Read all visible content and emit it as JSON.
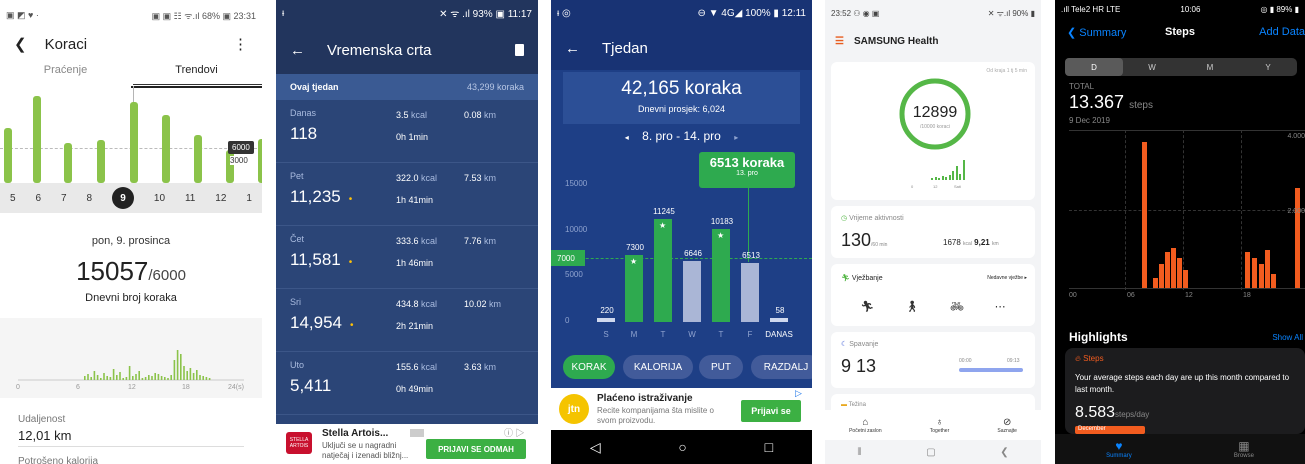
{
  "p1": {
    "status_left": "▣ ◩ ♥ ·",
    "status_right": "▣ ▣ ☷ ᯤ.ıl 68% ▣ 23:31",
    "title": "Koraci",
    "menu": "⋮",
    "tabs": [
      "Praćenje",
      "Trendovi"
    ],
    "goal_label": "6000",
    "goal2": "3000",
    "days": [
      "5",
      "6",
      "7",
      "8",
      "9",
      "10",
      "11",
      "12",
      "1"
    ],
    "bar_levels": [
      0.58,
      0.92,
      0.42,
      0.45,
      0.85,
      0.72,
      0.5,
      0.35,
      0.46
    ],
    "date": "pon, 9. prosinca",
    "steps": "15057",
    "goal": "/6000",
    "steps_label": "Dnevni broj koraka",
    "axis": [
      "0",
      "6",
      "12",
      "18",
      "24(s)"
    ],
    "dist_label": "Udaljenost",
    "dist_val": "12,01 km",
    "cal_label": "Potrošeno kalorija"
  },
  "p2": {
    "status_left": "ᵻ",
    "status_right": "✕ ᯤ .ıl 93% ▣ 11:17",
    "title": "Vremenska crta",
    "week_label": "Ovaj tjedan",
    "week_total": "43,299 koraka",
    "rows": [
      {
        "day": "Danas",
        "steps": "118",
        "kcal": "3.5",
        "kcal_u": "kcal",
        "time": "0h 1min",
        "km": "0.08",
        "km_u": "km",
        "star": ""
      },
      {
        "day": "Pet",
        "steps": "11,235",
        "kcal": "322.0",
        "kcal_u": "kcal",
        "time": "1h 41min",
        "km": "7.53",
        "km_u": "km",
        "star": "•"
      },
      {
        "day": "Čet",
        "steps": "11,581",
        "kcal": "333.6",
        "kcal_u": "kcal",
        "time": "1h 46min",
        "km": "7.76",
        "km_u": "km",
        "star": "•"
      },
      {
        "day": "Sri",
        "steps": "14,954",
        "kcal": "434.8",
        "kcal_u": "kcal",
        "time": "2h 21min",
        "km": "10.02",
        "km_u": "km",
        "star": "•"
      },
      {
        "day": "Uto",
        "steps": "5,411",
        "kcal": "155.6",
        "kcal_u": "kcal",
        "time": "0h 49min",
        "km": "3.63",
        "km_u": "km",
        "star": ""
      }
    ],
    "ad_title": "Stella Artois...",
    "ad_line1": "Uključi se u nagradni",
    "ad_line2": "natječaj i izenadi bližnj...",
    "ad_btn": "PRIJAVI SE ODMAH",
    "ad_logo": "STELLA ARTOIS"
  },
  "p3": {
    "status_left": "ᵻ ◎",
    "status_right": "⊖ ▼ 4G◢ 100% ▮ 12:11",
    "title": "Tjedan",
    "total": "42,165 koraka",
    "avg": "Dnevni prosjek: 6,024",
    "range": "8. pro - 14. pro",
    "tooltip": "6513 koraka",
    "tooltip_sub": "13. pro",
    "yticks": [
      "15000",
      "10000",
      "7000",
      "5000",
      "0"
    ],
    "bars": [
      {
        "v": 220,
        "l": "S"
      },
      {
        "v": 7300,
        "l": "M"
      },
      {
        "v": 11245,
        "l": "T"
      },
      {
        "v": 6646,
        "l": "W"
      },
      {
        "v": 10183,
        "l": "T"
      },
      {
        "v": 6513,
        "l": "F"
      },
      {
        "v": 58,
        "l": "DANAS"
      }
    ],
    "pills": [
      "KORAK",
      "KALORIJA",
      "PUT",
      "RAZDALJ"
    ],
    "ad_title": "Plaćeno istraživanje",
    "ad_line1": "Recite kompanijama šta mislite o",
    "ad_line2": "svom proizvodu.",
    "ad_btn": "Prijavi se",
    "ad_logo": "jtn"
  },
  "p4": {
    "status_left": "23:52 ⚇ ◉ ▣",
    "status_right": "✕ ᯤ.ıl 90% ▮",
    "brand": "SAMSUNG Health",
    "steps": "12899",
    "steps_goal": "/10000 koraci",
    "since": "Od kraja 1 tj 5 min",
    "active_label": "Vrijeme aktivnosti",
    "active_val": "130",
    "active_unit": "/60 min",
    "active_kcal": "1678",
    "kcal_u": "kcal",
    "active_km": "9,21",
    "km_u": "km",
    "ex_label": "Vježbanje",
    "ex_recent": "Nedavne vježbe ▸",
    "sleep_label": "Spavanje",
    "sleep_h": "9",
    "sleep_m": "13",
    "sleep_from": "00:00",
    "sleep_to": "09:13",
    "weight_label": "Težina",
    "nav": [
      "Početni zaslon",
      "Together",
      "Saznajte"
    ],
    "axis": [
      "0",
      "12",
      "Sati"
    ]
  },
  "p5": {
    "status_left": ".ıll Tele2 HR  LTE",
    "status_time": "10:06",
    "status_right": "◎ ▮ 89% ▮",
    "back": "Summary",
    "title": "Steps",
    "add": "Add Data",
    "seg": [
      "D",
      "W",
      "M",
      "Y"
    ],
    "total_label": "TOTAL",
    "total": "13.367",
    "total_unit": "steps",
    "date": "9 Dec 2019",
    "yticks": [
      "4.000",
      "2.000",
      "0"
    ],
    "xticks": [
      "00",
      "06",
      "12",
      "18"
    ],
    "hl_title": "Highlights",
    "show_all": "Show All",
    "hl_cat": "Steps",
    "hl_text": "Your average steps each day are up this month compared to last month.",
    "hl_val": "8.583",
    "hl_unit": "steps/day",
    "hl_tag": "December",
    "tabbar": [
      "Summary",
      "Browse"
    ]
  }
}
